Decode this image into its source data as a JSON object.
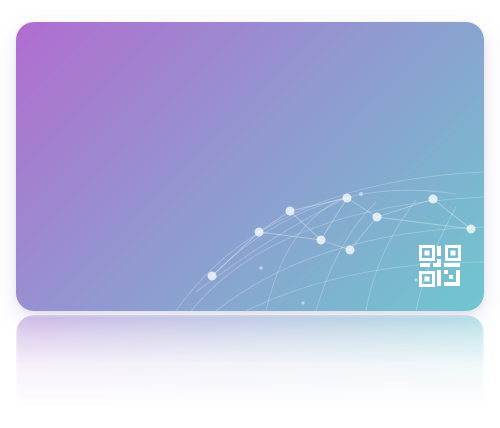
{
  "card": {
    "gradient_start": "#b16dd0",
    "gradient_end": "#6fc7cf",
    "accent": "#ffffff",
    "icon": "qr-code-icon",
    "pattern": "globe-network-pattern"
  }
}
